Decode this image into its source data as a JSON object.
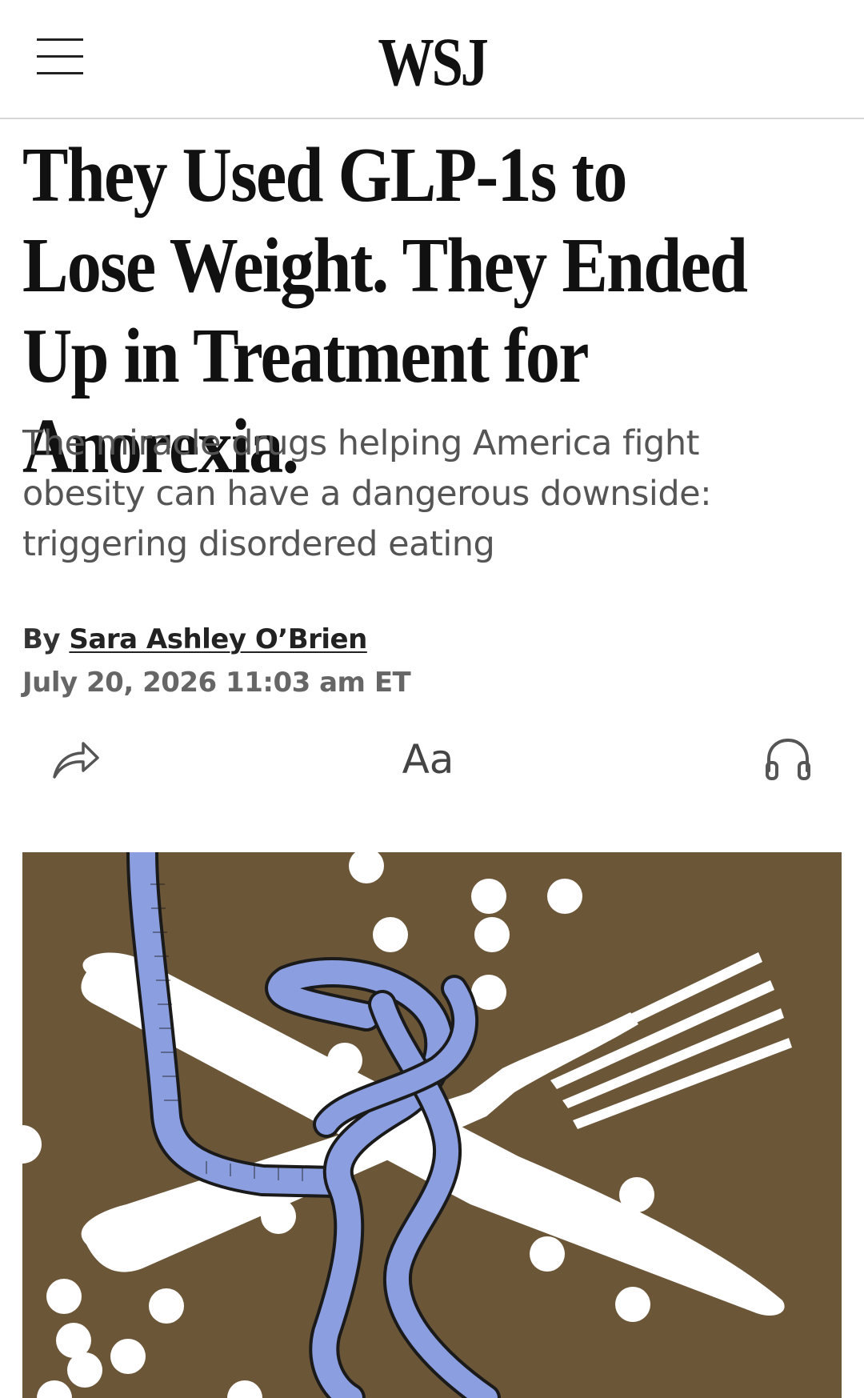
{
  "header": {
    "logo": "WSJ",
    "menu_icon": "hamburger-menu-icon"
  },
  "article": {
    "headline": "They Used GLP-1s to Lose Weight. They Ended Up in Treatment for Anorexia.",
    "dek": "The miracle drugs helping America fight obesity can have a dangerous downside: triggering disordered eating",
    "byline_prefix": "By ",
    "author": "Sara Ashley O’Brien",
    "timestamp": "July 20, 2026 11:03 am ET"
  },
  "toolbar": {
    "share_icon": "share-icon",
    "text_size_label": "Aa",
    "listen_icon": "headphones-icon"
  },
  "hero_image": {
    "description_icon": "fork-knife-tape-measure-illustration",
    "background_color": "#6b5638",
    "tape_color": "#8b9ee0"
  },
  "colors": {
    "headline": "#111111",
    "dek": "#555555",
    "timestamp": "#666666",
    "divider": "#d6d6d6"
  }
}
